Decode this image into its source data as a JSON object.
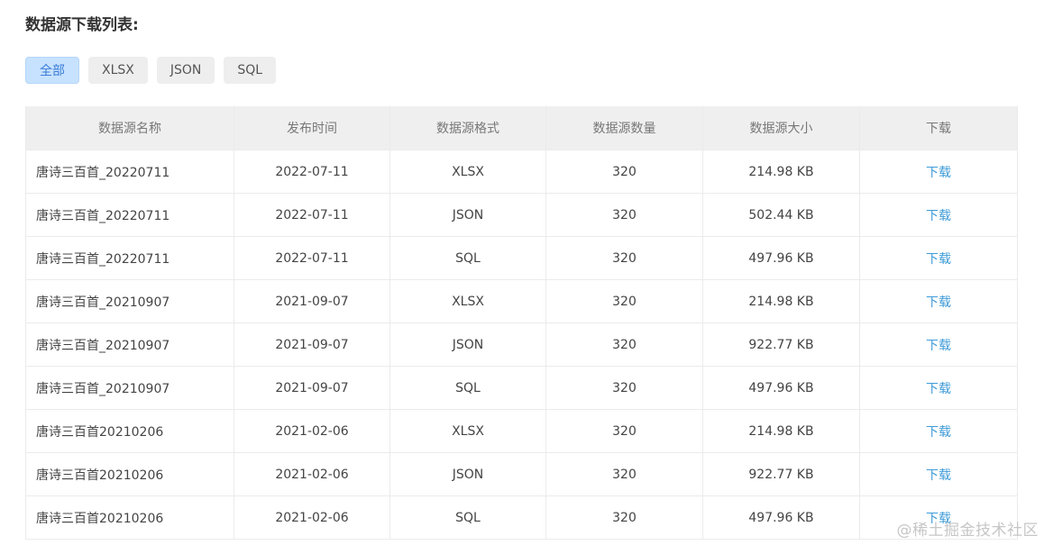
{
  "page": {
    "title": "数据源下载列表:"
  },
  "filters": [
    {
      "label": "全部",
      "active": true
    },
    {
      "label": "XLSX",
      "active": false
    },
    {
      "label": "JSON",
      "active": false
    },
    {
      "label": "SQL",
      "active": false
    }
  ],
  "table": {
    "headers": [
      "数据源名称",
      "发布时间",
      "数据源格式",
      "数据源数量",
      "数据源大小",
      "下载"
    ],
    "rows": [
      {
        "name": "唐诗三百首_20220711",
        "date": "2022-07-11",
        "format": "XLSX",
        "count": "320",
        "size": "214.98 KB",
        "download": "下载"
      },
      {
        "name": "唐诗三百首_20220711",
        "date": "2022-07-11",
        "format": "JSON",
        "count": "320",
        "size": "502.44 KB",
        "download": "下载"
      },
      {
        "name": "唐诗三百首_20220711",
        "date": "2022-07-11",
        "format": "SQL",
        "count": "320",
        "size": "497.96 KB",
        "download": "下载"
      },
      {
        "name": "唐诗三百首_20210907",
        "date": "2021-09-07",
        "format": "XLSX",
        "count": "320",
        "size": "214.98 KB",
        "download": "下载"
      },
      {
        "name": "唐诗三百首_20210907",
        "date": "2021-09-07",
        "format": "JSON",
        "count": "320",
        "size": "922.77 KB",
        "download": "下载"
      },
      {
        "name": "唐诗三百首_20210907",
        "date": "2021-09-07",
        "format": "SQL",
        "count": "320",
        "size": "497.96 KB",
        "download": "下载"
      },
      {
        "name": "唐诗三百首20210206",
        "date": "2021-02-06",
        "format": "XLSX",
        "count": "320",
        "size": "214.98 KB",
        "download": "下载"
      },
      {
        "name": "唐诗三百首20210206",
        "date": "2021-02-06",
        "format": "JSON",
        "count": "320",
        "size": "922.77 KB",
        "download": "下载"
      },
      {
        "name": "唐诗三百首20210206",
        "date": "2021-02-06",
        "format": "SQL",
        "count": "320",
        "size": "497.96 KB",
        "download": "下载"
      }
    ]
  },
  "watermark": "@稀土掘金技术社区",
  "colors": {
    "active_filter_bg": "#c7e2ff",
    "active_filter_text": "#3a7bd5",
    "link": "#3e9bd8",
    "header_bg": "#efefef"
  }
}
